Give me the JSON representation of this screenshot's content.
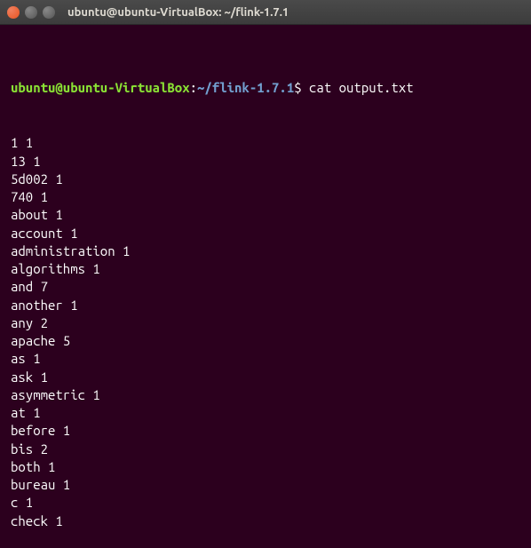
{
  "window": {
    "title": "ubuntu@ubuntu-VirtualBox: ~/flink-1.7.1"
  },
  "prompt": {
    "user_host": "ubuntu@ubuntu-VirtualBox",
    "colon": ":",
    "path": "~/flink-1.7.1",
    "dollar": "$",
    "command": " cat output.txt"
  },
  "lines": [
    "1 1",
    "13 1",
    "5d002 1",
    "740 1",
    "about 1",
    "account 1",
    "administration 1",
    "algorithms 1",
    "and 7",
    "another 1",
    "any 2",
    "apache 5",
    "as 1",
    "ask 1",
    "asymmetric 1",
    "at 1",
    "before 1",
    "bis 2",
    "both 1",
    "bureau 1",
    "c 1",
    "check 1"
  ]
}
